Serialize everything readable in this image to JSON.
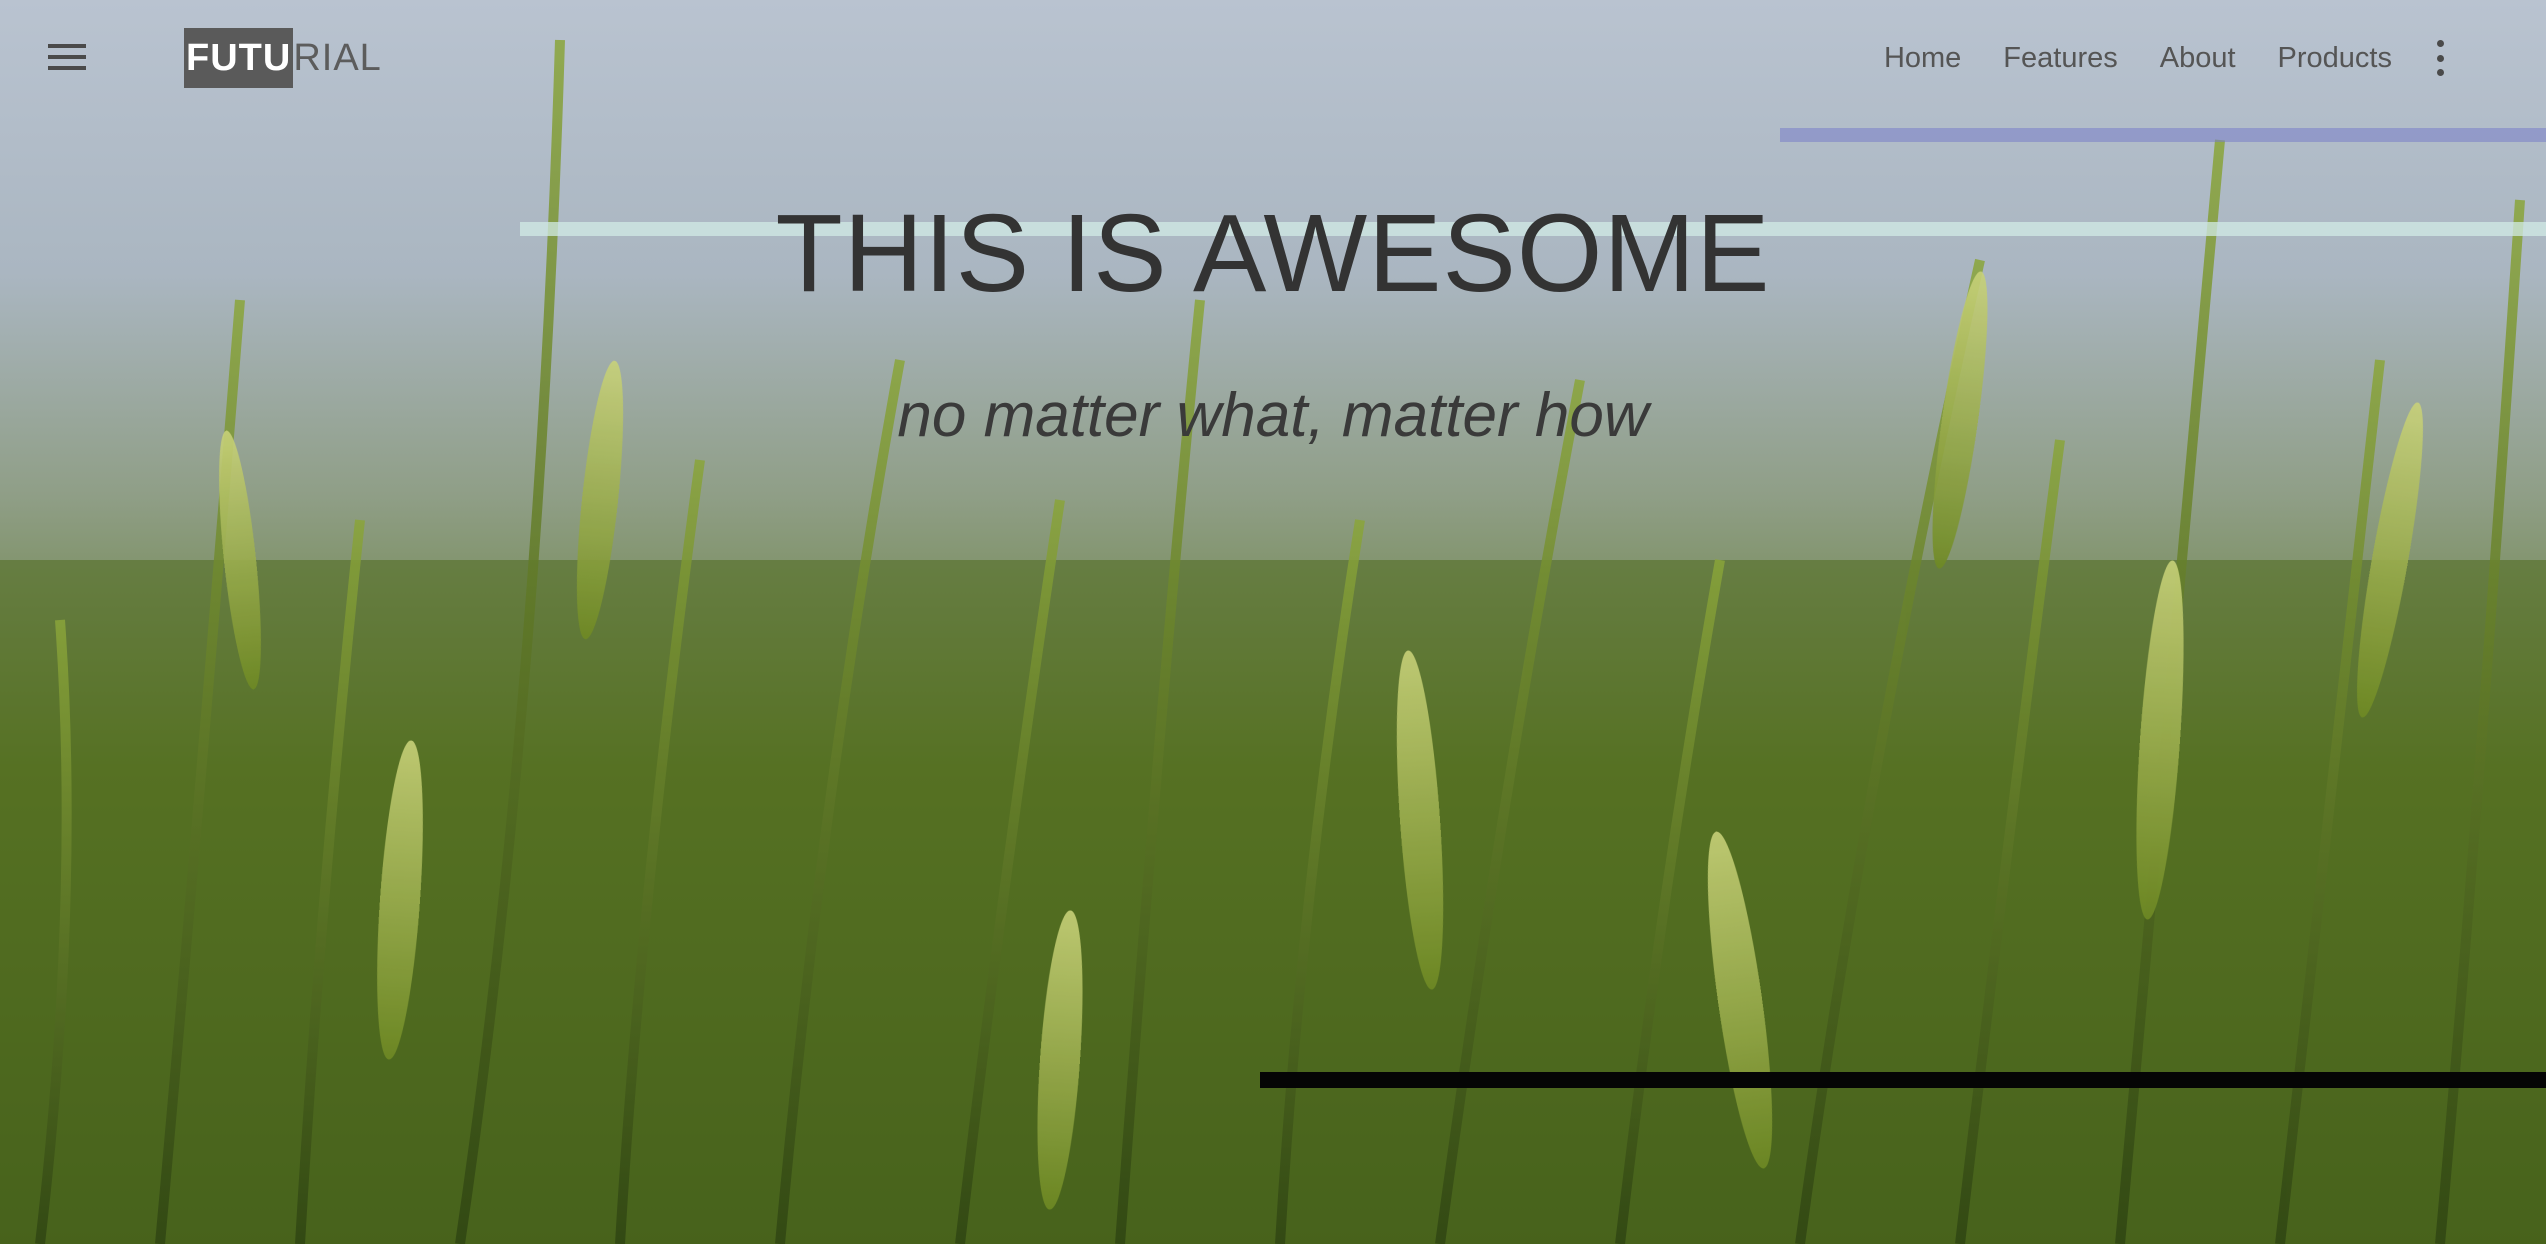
{
  "brand": {
    "highlighted": "FUTU",
    "rest": "RIAL"
  },
  "nav": {
    "items": [
      {
        "label": "Home"
      },
      {
        "label": "Features"
      },
      {
        "label": "About"
      },
      {
        "label": "Products"
      }
    ]
  },
  "hero": {
    "title": "THIS IS AWESOME",
    "subtitle": "no matter what, matter how"
  },
  "icons": {
    "menu": "hamburger-menu-icon",
    "more": "kebab-more-icon"
  },
  "colors": {
    "text_dark": "#333333",
    "brand_highlight_bg": "#5a5a5a",
    "sky": "#b9c3d0",
    "wheat_green": "#5f7a2a"
  }
}
